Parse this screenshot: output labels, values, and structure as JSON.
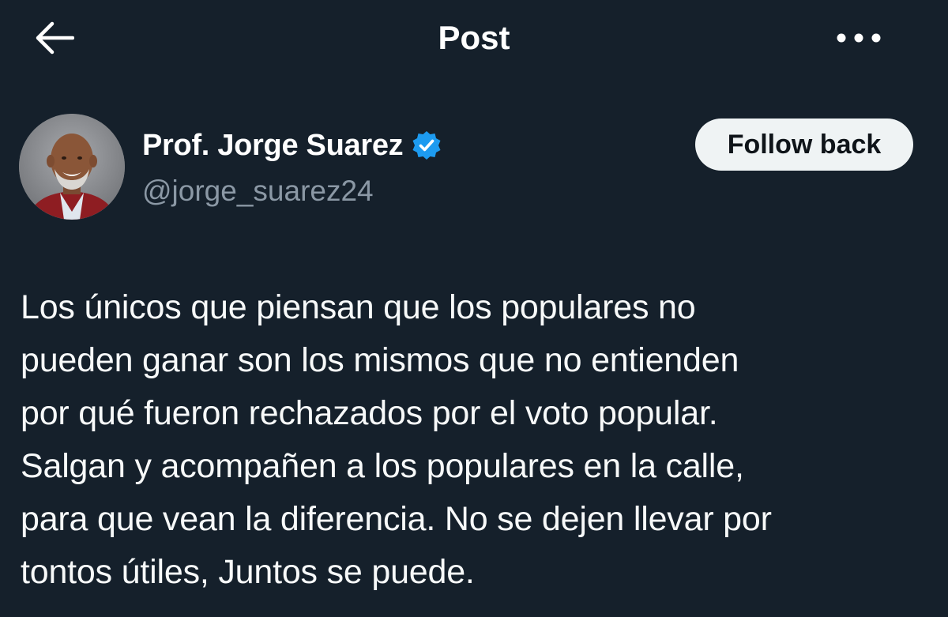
{
  "header": {
    "title": "Post",
    "back_icon": "arrow-left-icon",
    "more_icon": "ellipsis-horizontal-icon"
  },
  "author": {
    "name": "Prof. Jorge Suarez",
    "handle": "@jorge_suarez24",
    "verified": true,
    "verified_color": "#1d9bf0",
    "avatar_icon": "profile-photo"
  },
  "follow_button": {
    "label": "Follow back"
  },
  "post": {
    "lines": [
      "Los únicos que piensan que los populares no",
      "pueden ganar son los mismos que no entienden",
      "por qué fueron rechazados por el voto popular.",
      "Salgan y acompañen a los populares en la calle,",
      "para que vean la diferencia. No se dejen llevar por",
      "tontos útiles, Juntos se puede."
    ]
  },
  "colors": {
    "background": "#15202b",
    "text_primary": "#e7e9ea",
    "text_secondary": "#8b98a5",
    "button_bg": "#eff3f4"
  }
}
